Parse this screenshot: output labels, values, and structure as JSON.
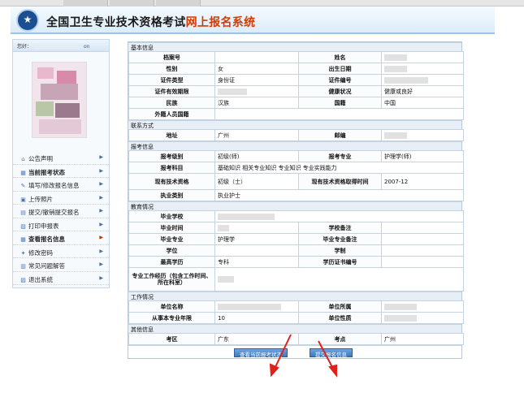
{
  "header": {
    "title_main": "全国卫生专业技术资格考试",
    "title_highlight": "网上报名系统"
  },
  "sidebar": {
    "greeting": "您好：",
    "greeting_tail": "on",
    "menu": [
      {
        "label": "公告声明",
        "icon": "house-icon",
        "bold": false
      },
      {
        "label": "当前报考状态",
        "icon": "grid-icon",
        "bold": true
      },
      {
        "label": "填写/修改报名信息",
        "icon": "edit-icon",
        "bold": false
      },
      {
        "label": "上传照片",
        "icon": "photo-icon",
        "bold": false
      },
      {
        "label": "提交/撤销提交报名",
        "icon": "submit-icon",
        "bold": false
      },
      {
        "label": "打印申报表",
        "icon": "print-icon",
        "bold": false
      },
      {
        "label": "查看报名信息",
        "icon": "grid-icon",
        "bold": true
      },
      {
        "label": "修改密码",
        "icon": "key-icon",
        "bold": false
      },
      {
        "label": "常见问题解答",
        "icon": "faq-icon",
        "bold": false
      },
      {
        "label": "退出系统",
        "icon": "exit-icon",
        "bold": false
      }
    ]
  },
  "sections": {
    "basic": "基本信息",
    "contact": "联系方式",
    "exam": "报考信息",
    "edu": "教育情况",
    "work": "工作情况",
    "other": "其他信息"
  },
  "labels": {
    "archive_no": "档案号",
    "name": "姓名",
    "gender": "性别",
    "birth": "出生日期",
    "id_type": "证件类型",
    "id_no": "证件编号",
    "id_valid": "证件有效期限",
    "health": "健康状况",
    "ethnic": "民族",
    "nation": "国籍",
    "foreign": "外籍人员国籍",
    "address": "地址",
    "postcode": "邮编",
    "exam_level": "报考级别",
    "exam_major": "报考专业",
    "exam_subject": "报考科目",
    "cur_title": "现有技术资格",
    "cur_title_time": "现有技术资格取得时间",
    "practice": "执业类别",
    "school": "毕业学校",
    "grad_time": "毕业时间",
    "school_note": "学校备注",
    "grad_major": "毕业专业",
    "major_note": "毕业专业备注",
    "degree": "学位",
    "schooling": "学制",
    "edu_level": "最高学历",
    "cert_no": "学历证书编号",
    "experience": "专业工作经历（包含工作时间、所在科室）",
    "unit": "单位名称",
    "unit_type": "单位所属",
    "years": "从事本专业年限",
    "unit_nature": "单位性质",
    "exam_area": "考区",
    "exam_site": "考点"
  },
  "values": {
    "gender": "女",
    "id_type": "身份证",
    "health": "健康或良好",
    "ethnic": "汉族",
    "nation": "中国",
    "address": "广州",
    "exam_level": "初级(师)",
    "exam_major": "护理学(师)",
    "exam_subject": "基础知识  相关专业知识  专业知识  专业实践能力",
    "cur_title": "初级（士）",
    "cur_title_time": "2007-12",
    "practice": "执业护士",
    "grad_major": "护理学",
    "edu_level": "专科",
    "years": "10",
    "exam_area": "广东",
    "exam_site": "广州"
  },
  "buttons": {
    "view_status": "查看当前报考状态",
    "submit": "提交报名信息"
  },
  "colors": {
    "accent": "#d33b00",
    "button": "#3e78bf",
    "annotation_arrow": "#e0201a"
  }
}
